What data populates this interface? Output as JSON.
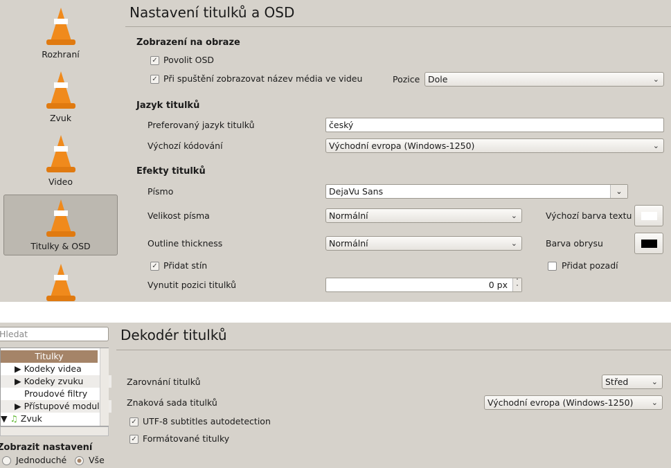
{
  "top": {
    "sidebar": [
      {
        "label": "Rozhraní"
      },
      {
        "label": "Zvuk"
      },
      {
        "label": "Video"
      },
      {
        "label": "Titulky & OSD",
        "selected": true
      },
      {
        "label": ""
      }
    ],
    "title": "Nastavení titulků a OSD",
    "osd": {
      "heading": "Zobrazení na obraze",
      "enable_osd": "Povolit OSD",
      "show_title": "Při spuštění zobrazovat název média ve videu",
      "position_label": "Pozice",
      "position_value": "Dole"
    },
    "lang": {
      "heading": "Jazyk titulků",
      "pref_label": "Preferovaný jazyk titulků",
      "pref_value": "český",
      "enc_label": "Výchozí kódování",
      "enc_value": "Východní evropa (Windows-1250)"
    },
    "effects": {
      "heading": "Efekty titulků",
      "font_label": "Písmo",
      "font_value": "DejaVu Sans",
      "size_label": "Velikost písma",
      "size_value": "Normální",
      "text_color_label": "Výchozí barva textu",
      "text_color": "#ffffff",
      "outline_label": "Outline thickness",
      "outline_value": "Normální",
      "outline_color_label": "Barva obrysu",
      "outline_color": "#000000",
      "shadow_label": "Přidat stín",
      "background_label": "Přidat pozadí",
      "force_pos_label": "Vynutit pozici titulků",
      "force_pos_value": "0 px"
    }
  },
  "bottom": {
    "search_placeholder": "Hledat",
    "tree": [
      {
        "label": "Titulky",
        "selected": true
      },
      {
        "label": "Kodeky videa"
      },
      {
        "label": "Kodeky zvuku"
      },
      {
        "label": "Proudové filtry"
      },
      {
        "label": "Přístupové moduly"
      },
      {
        "label": "Zvuk"
      }
    ],
    "show_settings": "Zobrazit nastavení",
    "simple": "Jednoduché",
    "all": "Vše",
    "title": "Dekodér titulků",
    "align_label": "Zarovnání titulků",
    "align_value": "Střed",
    "charset_label": "Znaková sada titulků",
    "charset_value": "Východní evropa (Windows-1250)",
    "utf8_label": "UTF-8 subtitles autodetection",
    "formatted_label": "Formátované titulky"
  }
}
